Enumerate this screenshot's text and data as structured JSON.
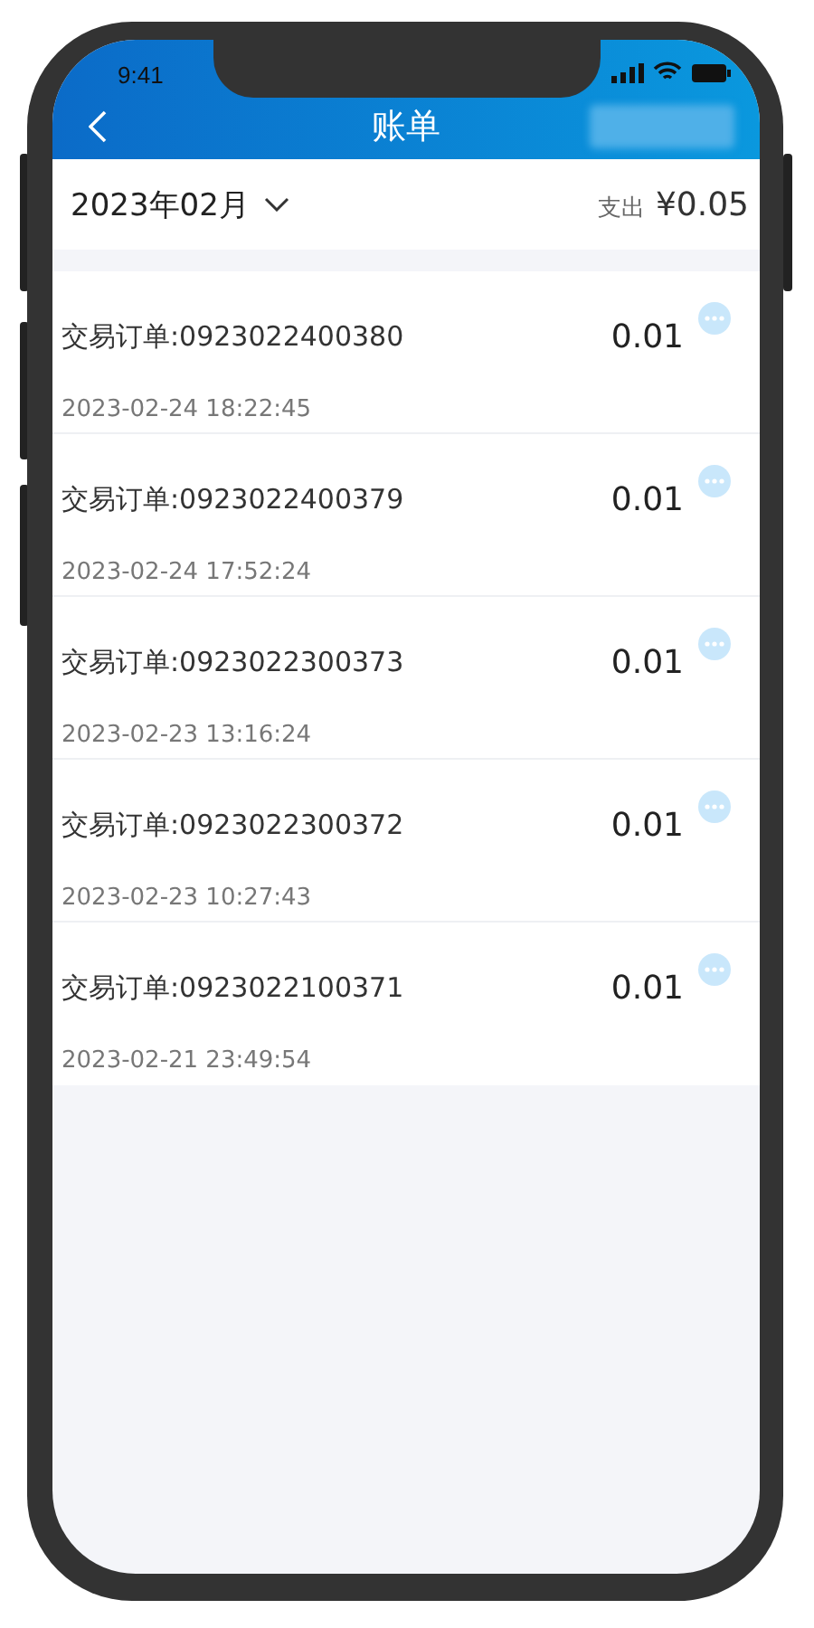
{
  "status_bar": {
    "time": "9:41"
  },
  "nav": {
    "title": "账单"
  },
  "summary": {
    "month": "2023年02月",
    "expense_label": "支出",
    "expense_value": "¥0.05"
  },
  "orders": [
    {
      "title": "交易订单:0923022400380",
      "time": "2023-02-24 18:22:45",
      "amount": "0.01"
    },
    {
      "title": "交易订单:0923022400379",
      "time": "2023-02-24 17:52:24",
      "amount": "0.01"
    },
    {
      "title": "交易订单:0923022300373",
      "time": "2023-02-23 13:16:24",
      "amount": "0.01"
    },
    {
      "title": "交易订单:0923022300372",
      "time": "2023-02-23 10:27:43",
      "amount": "0.01"
    },
    {
      "title": "交易订单:0923022100371",
      "time": "2023-02-21 23:49:54",
      "amount": "0.01"
    }
  ]
}
